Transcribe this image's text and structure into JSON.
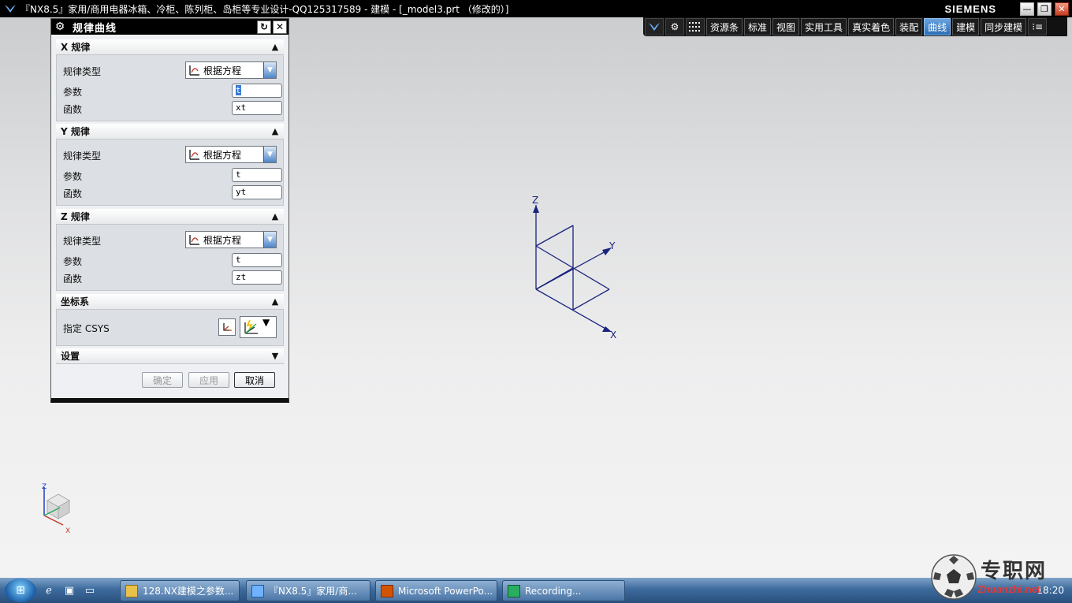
{
  "window": {
    "title": "『NX8.5』家用/商用电器冰箱、冷柜、陈列柜、岛柜等专业设计-QQ125317589 - 建模 - [_model3.prt （修改的）]",
    "brand": "SIEMENS"
  },
  "toolbar": {
    "tabs": [
      "资源条",
      "标准",
      "视图",
      "实用工具",
      "真实着色",
      "装配",
      "曲线",
      "建模",
      "同步建模"
    ],
    "active_tab": "曲线"
  },
  "dialog": {
    "title": "规律曲线",
    "sections": {
      "x": {
        "header": "X 规律",
        "law_type_label": "规律类型",
        "law_type_value": "根据方程",
        "param_label": "参数",
        "param_value": "t",
        "func_label": "函数",
        "func_value": "xt"
      },
      "y": {
        "header": "Y 规律",
        "law_type_label": "规律类型",
        "law_type_value": "根据方程",
        "param_label": "参数",
        "param_value": "t",
        "func_label": "函数",
        "func_value": "yt"
      },
      "z": {
        "header": "Z 规律",
        "law_type_label": "规律类型",
        "law_type_value": "根据方程",
        "param_label": "参数",
        "param_value": "t",
        "func_label": "函数",
        "func_value": "zt"
      },
      "csys": {
        "header": "坐标系",
        "specify_label": "指定 CSYS"
      },
      "settings": {
        "header": "设置"
      }
    },
    "buttons": {
      "ok": "确定",
      "apply": "应用",
      "cancel": "取消"
    }
  },
  "viewport": {
    "axis_labels": {
      "z": "Z",
      "y": "Y",
      "x": "X"
    },
    "axis_color": "#1a237e"
  },
  "taskbar": {
    "items": [
      "128.NX建模之参数...",
      "『NX8.5』家用/商...",
      "Microsoft PowerPo...",
      "Recording..."
    ],
    "clock": "18:20"
  },
  "watermark": {
    "text": "专职网",
    "url": "Zhuanzhi.net"
  }
}
